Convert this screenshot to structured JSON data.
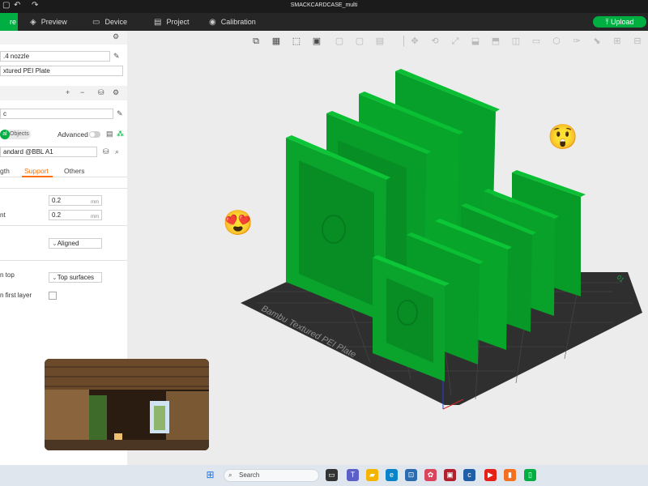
{
  "window": {
    "title": "SMACKCARDCASE_multi"
  },
  "menubar": {
    "tabs": [
      {
        "label": "re",
        "icon": "prepare-icon"
      },
      {
        "label": "Preview",
        "icon": "preview-icon"
      },
      {
        "label": "Device",
        "icon": "device-icon"
      },
      {
        "label": "Project",
        "icon": "project-icon"
      },
      {
        "label": "Calibration",
        "icon": "calibration-icon"
      }
    ],
    "upload_label": "Upload"
  },
  "printer": {
    "nozzle": ".4 nozzle",
    "plate": "xtured PEI Plate"
  },
  "process": {
    "preset_value": "c",
    "scope_left": "al",
    "scope_right": "Objects",
    "advanced_label": "Advanced",
    "profile": "andard @BBL A1",
    "tabs": [
      "gth",
      "Support",
      "Others"
    ],
    "active_tab": "Support"
  },
  "settings": {
    "value1": "0.2",
    "value2_label": "nt",
    "value2": "0.2",
    "unit": "mm",
    "aligned_value": "Aligned",
    "top_label": "n top",
    "top_value": "Top surfaces",
    "first_layer_label": "n first layer"
  },
  "plate_label": "Bambu Textured PEI Plate",
  "plate_number": "01",
  "colors": {
    "accent": "#00ae42",
    "model": "#079b28",
    "plate": "#2f2f2f"
  },
  "taskbar": {
    "search_placeholder": "Search"
  }
}
